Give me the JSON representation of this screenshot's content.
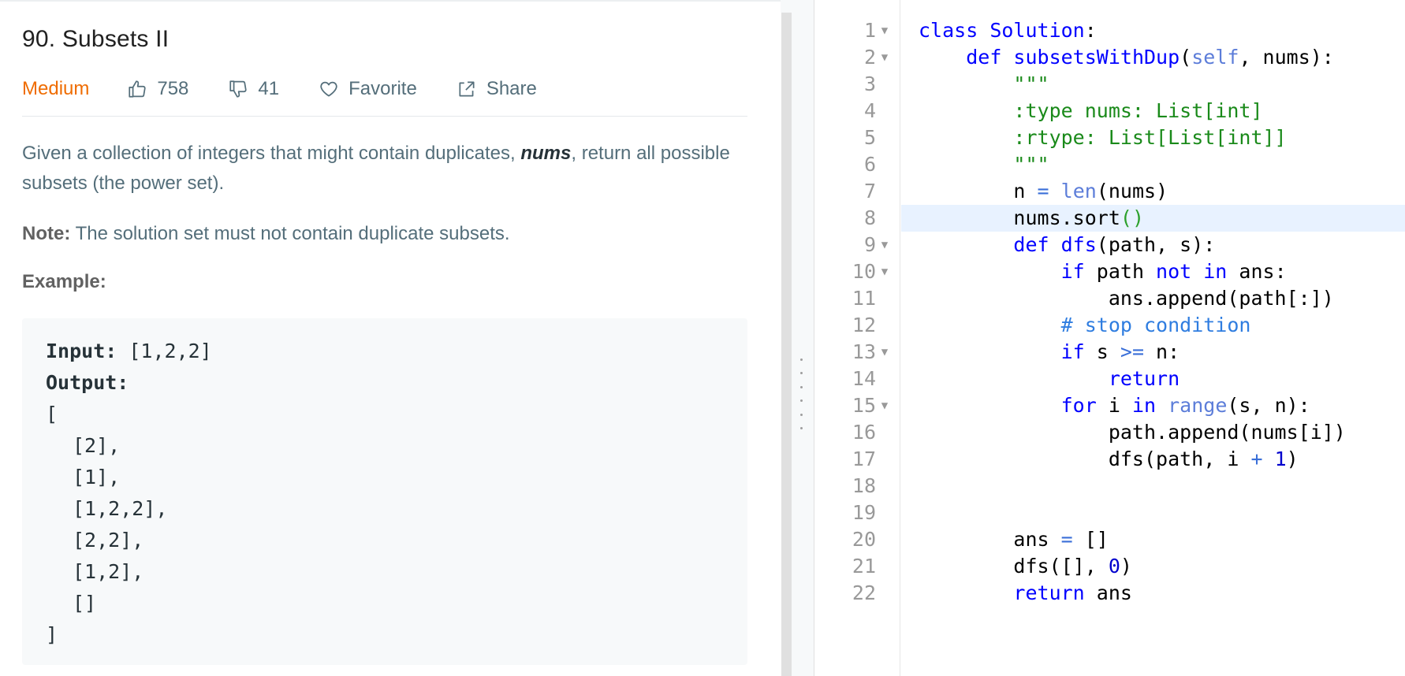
{
  "problem": {
    "title": "90. Subsets II",
    "difficulty": "Medium",
    "likes": "758",
    "dislikes": "41",
    "favorite_label": "Favorite",
    "share_label": "Share",
    "desc_before": "Given a collection of integers that might contain duplicates, ",
    "desc_em": "nums",
    "desc_after": ", return all possible subsets (the power set).",
    "note_label": "Note:",
    "note_text": " The solution set must not contain duplicate subsets.",
    "example_label": "Example:",
    "example": {
      "input_label": "Input:",
      "input_value": " [1,2,2]",
      "output_label": "Output:",
      "output_lines": [
        "[",
        "[2],",
        "[1],",
        "[1,2,2],",
        "[2,2],",
        "[1,2],",
        "[]",
        "]"
      ]
    }
  },
  "editor": {
    "active_line": 8,
    "lines": [
      {
        "n": "1",
        "fold": true
      },
      {
        "n": "2",
        "fold": true
      },
      {
        "n": "3",
        "fold": false
      },
      {
        "n": "4",
        "fold": false
      },
      {
        "n": "5",
        "fold": false
      },
      {
        "n": "6",
        "fold": false
      },
      {
        "n": "7",
        "fold": false
      },
      {
        "n": "8",
        "fold": false
      },
      {
        "n": "9",
        "fold": true
      },
      {
        "n": "10",
        "fold": true
      },
      {
        "n": "11",
        "fold": false
      },
      {
        "n": "12",
        "fold": false
      },
      {
        "n": "13",
        "fold": true
      },
      {
        "n": "14",
        "fold": false
      },
      {
        "n": "15",
        "fold": true
      },
      {
        "n": "16",
        "fold": false
      },
      {
        "n": "17",
        "fold": false
      },
      {
        "n": "18",
        "fold": false
      },
      {
        "n": "19",
        "fold": false
      },
      {
        "n": "20",
        "fold": false
      },
      {
        "n": "21",
        "fold": false
      },
      {
        "n": "22",
        "fold": false
      }
    ],
    "code": {
      "l1_kw": "class",
      "l1_name": " Solution",
      "l1_rest": ":",
      "l2_kw": "def",
      "l2_name": " subsetsWithDup",
      "l2_p1": "(",
      "l2_self": "self",
      "l2_rest": ", nums):",
      "l3": "\"\"\"",
      "l4": ":type nums: List[int]",
      "l5": ":rtype: List[List[int]]",
      "l6": "\"\"\"",
      "l7_a": "n ",
      "l7_op": "=",
      "l7_sp": " ",
      "l7_len": "len",
      "l7_b": "(nums)",
      "l8_a": "nums.sort",
      "l8_paren": "()",
      "l9_kw": "def",
      "l9_name": " dfs",
      "l9_rest": "(path, s):",
      "l10_kw": "if",
      "l10_a": " path ",
      "l10_kw2": "not in",
      "l10_b": " ans:",
      "l11": "ans.append(path[:])",
      "l12": "# stop condition",
      "l13_kw": "if",
      "l13_a": " s ",
      "l13_op": ">=",
      "l13_b": " n:",
      "l14": "return",
      "l15_kw": "for",
      "l15_a": " i ",
      "l15_in": "in",
      "l15_sp": " ",
      "l15_range": "range",
      "l15_b": "(s, n):",
      "l16": "path.append(nums[i])",
      "l17_a": "dfs(path, i ",
      "l17_op": "+",
      "l17_sp": " ",
      "l17_num": "1",
      "l17_b": ")",
      "l19": "",
      "l20_a": "ans ",
      "l20_op": "=",
      "l20_b": " []",
      "l21_a": "dfs([], ",
      "l21_num": "0",
      "l21_b": ")",
      "l22_kw": "return",
      "l22_a": " ans"
    }
  }
}
